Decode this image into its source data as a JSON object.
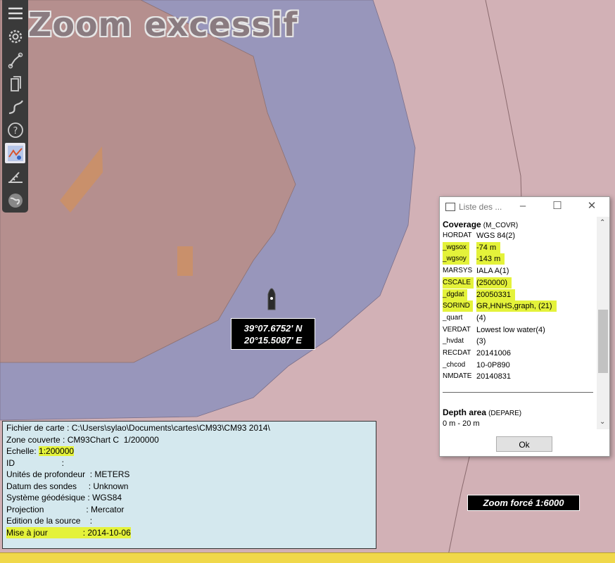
{
  "map": {
    "zoom_warning": "Zoom excessif"
  },
  "toolbar": {
    "items": [
      "menu-icon",
      "settings-icon",
      "route-icon",
      "document-icon",
      "track-icon",
      "help-icon",
      "chart-icon",
      "measure-icon",
      "globe-icon"
    ]
  },
  "position": {
    "lat": "39°07.6752' N",
    "lon": "20°15.5087' E"
  },
  "zoom_forced": "Zoom forcé 1:6000",
  "info": {
    "file": "Fichier de carte : C:\\Users\\sylao\\Documents\\cartes\\CM93\\CM93 2014\\",
    "zone": "Zone couverte : CM93Chart C  1/200000",
    "scale_label": "Echelle: ",
    "scale_value": "1:200000",
    "id": "ID                    :",
    "depth_units": "Unités de profondeur  : METERS",
    "sounding_datum": "Datum des sondes     : Unknown",
    "geodetic": "Système géodésique : WGS84",
    "projection": "Projection                  : Mercator",
    "edition": "Edition de la source    :",
    "update": "Mise à jour               : 2014-10-06"
  },
  "dialog": {
    "title": "Liste des ...",
    "ok": "Ok",
    "coverage_title": "Coverage",
    "coverage_code": "(M_COVR)",
    "attributes": [
      {
        "key": "HORDAT",
        "value": "WGS 84(2)",
        "hl": false
      },
      {
        "key": "_wgsox",
        "value": "-74 m",
        "hl": true
      },
      {
        "key": "_wgsoy",
        "value": "-143 m",
        "hl": true
      },
      {
        "key": "MARSYS",
        "value": "IALA A(1)",
        "hl": false
      },
      {
        "key": "CSCALE",
        "value": "(250000)",
        "hl": true
      },
      {
        "key": "_dgdat",
        "value": "20050331",
        "hl": true
      },
      {
        "key": "SORIND",
        "value": "GR,HNHS,graph, (21)",
        "hl": true
      },
      {
        "key": "_quart",
        "value": "(4)",
        "hl": false
      },
      {
        "key": "VERDAT",
        "value": "Lowest low water(4)",
        "hl": false
      },
      {
        "key": "_hvdat",
        "value": "(3)",
        "hl": false
      },
      {
        "key": "RECDAT",
        "value": "20141006",
        "hl": false
      },
      {
        "key": "_chcod",
        "value": "10-0P890",
        "hl": false
      },
      {
        "key": "NMDATE",
        "value": "20140831",
        "hl": false
      }
    ],
    "depth_title": "Depth area",
    "depth_code": "(DEPARE)",
    "depth_range": "0 m - 20 m"
  },
  "colors": {
    "land": "#d2b1b6",
    "shallow": "#9896bb",
    "landmass": "#b58f8e",
    "highlight": "#e4f23a",
    "info_bg": "#d4e8ee",
    "status": "#f0d84a"
  }
}
